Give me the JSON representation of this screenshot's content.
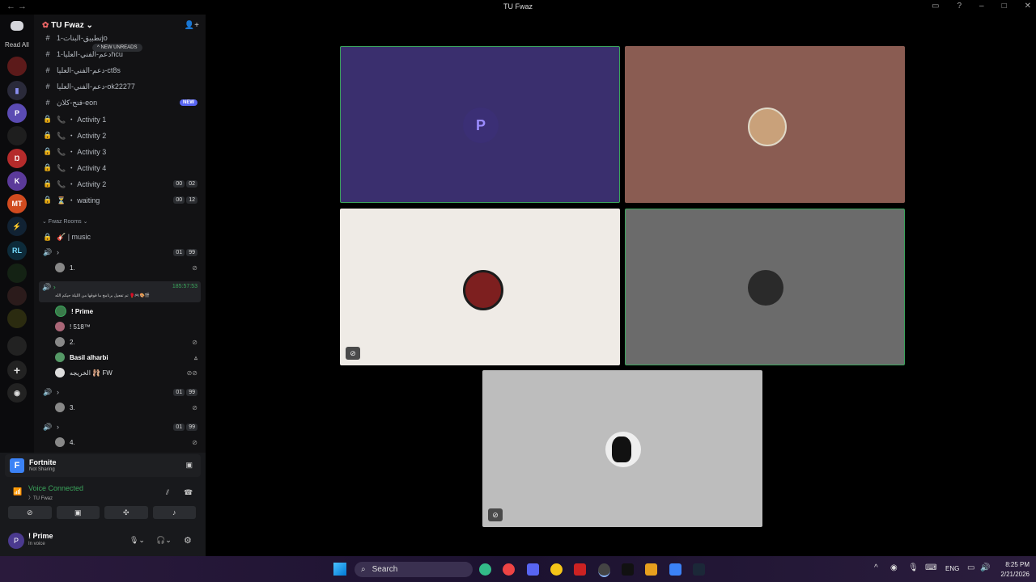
{
  "window": {
    "title": "TU Fwaz"
  },
  "rail": {
    "read_all": "Read All"
  },
  "server": {
    "name": "TU Fwaz",
    "new_unreads": "NEW UNREADS"
  },
  "channels": [
    {
      "icon": "#",
      "label": "تطبيق-البنات-1jo"
    },
    {
      "icon": "#",
      "label": "دعم-الفني-العليا-1hcu"
    },
    {
      "icon": "#",
      "label": "دعم-الفني-العليا-ct8s"
    },
    {
      "icon": "#",
      "label": "دعم-الفني-العليا-ok22277"
    },
    {
      "icon": "#",
      "label": "فتح-كلان-eon",
      "badge": "NEW"
    },
    {
      "icon": "🔒",
      "label": "📞 ・ Activity 1"
    },
    {
      "icon": "🔒",
      "label": "📞 ・ Activity 2"
    },
    {
      "icon": "🔒",
      "label": "📞 ・ Activity 3"
    },
    {
      "icon": "🔒",
      "label": "📞 ・ Activity 4"
    },
    {
      "icon": "🔒",
      "label": "📞 ・ Activity 2",
      "counts": [
        "00",
        "02"
      ]
    },
    {
      "icon": "🔒",
      "label": "⏳ ・ waiting",
      "counts": [
        "00",
        "12"
      ]
    }
  ],
  "category": "⌄ Fwaz Rooms ⌄",
  "music": {
    "label": "🎸 | music"
  },
  "voice_rooms": [
    {
      "counts": [
        "01",
        "99"
      ],
      "member": "1."
    },
    {
      "timer": "185:57:53",
      "status": "تم تفعيل برنامج ما فوقها من الليلة حيكم الله 🥊🎮🎨🎬"
    },
    {
      "counts": [
        "01",
        "99"
      ],
      "member": "3."
    },
    {
      "counts": [
        "01",
        "99"
      ],
      "member": "4."
    }
  ],
  "active_room_members": [
    {
      "name": "! Prime"
    },
    {
      "name": "! 518™"
    },
    {
      "name": "2."
    },
    {
      "name": "Basil alharbi"
    },
    {
      "name": "الخريجه 🩰 FW"
    }
  ],
  "activity": {
    "game": "Fortnite",
    "state": "Not Sharing"
  },
  "voice": {
    "status": "Voice Connected",
    "channel": "〉TU Fwaz"
  },
  "account": {
    "name": "! Prime",
    "status": "In voice"
  },
  "taskbar": {
    "search": "Search",
    "lang": "ENG",
    "time": "8:25 PM",
    "date": "2/21/2026"
  },
  "tiles": [
    {
      "bg": "#3a2f6e",
      "speaking": true,
      "muted": false
    },
    {
      "bg": "#8a5c52",
      "speaking": false,
      "muted": false
    },
    {
      "bg": "#efebe6",
      "speaking": false,
      "muted": true
    },
    {
      "bg": "#6b6b6b",
      "speaking": true,
      "muted": false
    },
    {
      "bg": "#bdbdbd",
      "speaking": false,
      "muted": true
    }
  ]
}
